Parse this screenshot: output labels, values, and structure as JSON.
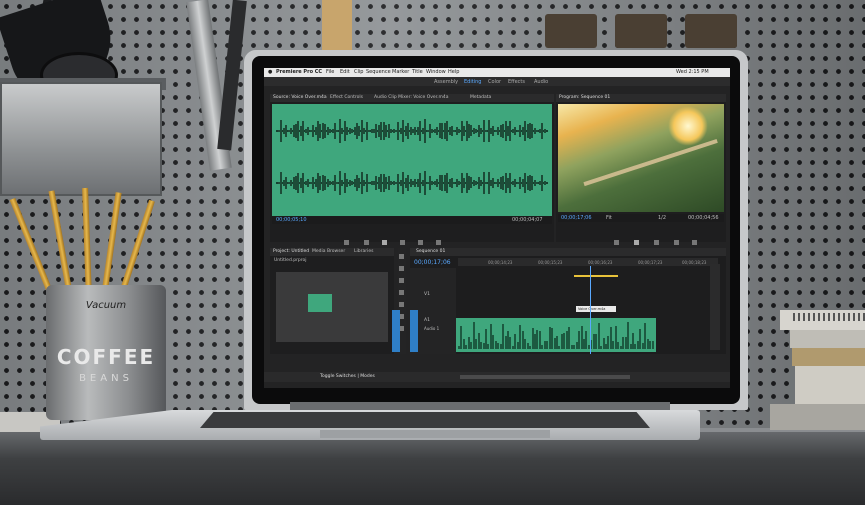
{
  "scene": {
    "wall_color": "#8d9194",
    "desk_color": "#3e4042"
  },
  "can": {
    "title": "COFFEE",
    "subtitle": "BEANS",
    "brand": "Vacuum"
  },
  "app": {
    "name": "Premiere Pro CC",
    "menu": [
      "File",
      "Edit",
      "Clip",
      "Sequence",
      "Marker",
      "Title",
      "Window",
      "Help"
    ],
    "clock": "Wed 2:15 PM"
  },
  "workspace_tabs": [
    "Assembly",
    "Editing",
    "Color",
    "Effects",
    "Audio"
  ],
  "active_workspace": "Editing",
  "source_panel": {
    "tabs": [
      "Source: Voice Over.m4a",
      "Effect Controls",
      "Audio Clip Mixer: Voice Over.m4a",
      "Metadata"
    ],
    "timecode_in": "00;00;05;10",
    "timecode_out": "00;00;04;07",
    "waveform_color": "#3fa77d"
  },
  "program_panel": {
    "tab": "Program: Sequence 01",
    "timecode": "00;00;17;06",
    "zoom": "Fit",
    "scale": "1/2",
    "duration": "00;00;04;56"
  },
  "project_panel": {
    "tabs": [
      "Project: Untitled",
      "Media Browser",
      "Libraries"
    ],
    "project_file": "Untitled.prproj"
  },
  "timeline": {
    "tab": "Sequence 01",
    "timecode": "00;00;17;06",
    "ruler": [
      "00;00;14;23",
      "00;00;15;23",
      "00;00;16;23",
      "00;00;17;23",
      "00;00;18;23"
    ],
    "track_labels": [
      "V1",
      "A1",
      "Audio 1"
    ],
    "tooltip": "Voice Over.m4a",
    "playhead_color": "#5aa9ff"
  },
  "status": {
    "label": "Toggle Switches | Modes"
  }
}
